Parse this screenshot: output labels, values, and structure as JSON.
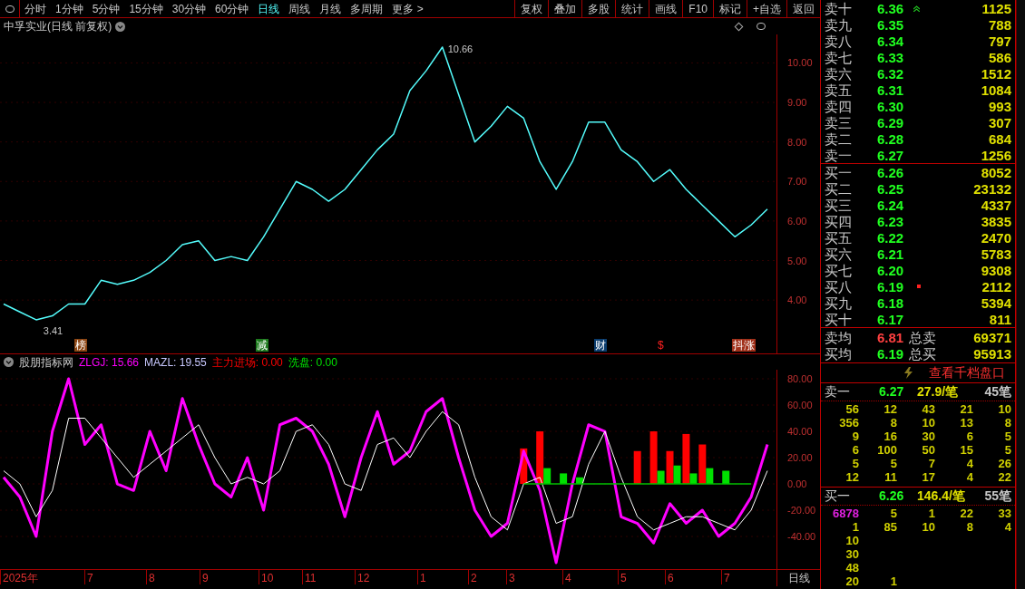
{
  "toolbar": {
    "periods": [
      {
        "label": "分时",
        "selected": false
      },
      {
        "label": "1分钟",
        "selected": false
      },
      {
        "label": "5分钟",
        "selected": false
      },
      {
        "label": "15分钟",
        "selected": false
      },
      {
        "label": "30分钟",
        "selected": false
      },
      {
        "label": "60分钟",
        "selected": false
      },
      {
        "label": "日线",
        "selected": true
      },
      {
        "label": "周线",
        "selected": false
      },
      {
        "label": "月线",
        "selected": false
      },
      {
        "label": "多周期",
        "selected": false
      },
      {
        "label": "更多 >",
        "selected": false
      }
    ],
    "actions": [
      "复权",
      "叠加",
      "多股",
      "统计",
      "画线",
      "F10",
      "标记",
      "+自选",
      "返回"
    ]
  },
  "price_chart": {
    "title": "中孚实业(日线 前复权)",
    "high_label": "10.66",
    "low_label": "3.41",
    "events": [
      {
        "text": "榜",
        "kind": "badge",
        "color": "#8b4513"
      },
      {
        "text": "减",
        "kind": "badge",
        "color": "#1e7a1e"
      },
      {
        "text": "财",
        "kind": "badge",
        "color": "#0b3d6e"
      },
      {
        "text": "$",
        "kind": "text",
        "color": "#ff2020"
      },
      {
        "text": "抖涨",
        "kind": "badge",
        "color": "#a0301a"
      }
    ],
    "chart_data": {
      "type": "line",
      "grid": true,
      "ylim": [
        3.04,
        10.72
      ],
      "yticks": [
        {
          "value": 4,
          "label": "4.00"
        },
        {
          "value": 5,
          "label": "5.00"
        },
        {
          "value": 6,
          "label": "6.00"
        },
        {
          "value": 7,
          "label": "7.00"
        },
        {
          "value": 8,
          "label": "8.00"
        },
        {
          "value": 9,
          "label": "9.00"
        },
        {
          "value": 10,
          "label": "10.00"
        }
      ],
      "series": [
        {
          "color": "#54fcfc",
          "values": [
            3.9,
            3.7,
            3.5,
            3.6,
            3.9,
            3.9,
            4.5,
            4.4,
            4.5,
            4.7,
            5.0,
            5.4,
            5.5,
            5.0,
            5.1,
            5.0,
            5.6,
            6.3,
            7.0,
            6.8,
            6.5,
            6.8,
            7.3,
            7.8,
            8.2,
            9.3,
            9.8,
            10.4,
            9.2,
            8.0,
            8.4,
            8.9,
            8.6,
            7.5,
            6.8,
            7.5,
            8.5,
            8.5,
            7.8,
            7.5,
            7.0,
            7.3,
            6.8,
            6.4,
            6.0,
            5.6,
            5.9,
            6.3
          ]
        }
      ]
    }
  },
  "indicator": {
    "name": "股朋指标网",
    "readings": [
      ": 15.66",
      ": 19.55",
      ": 0.00",
      ": 0.00"
    ],
    "chart_data": {
      "type": "line",
      "grid": true,
      "ylim": [
        -64.8,
        86.9
      ],
      "yticks": [
        {
          "value": -40,
          "label": "-40.00"
        },
        {
          "value": -20,
          "label": "-20.00"
        },
        {
          "value": 0,
          "label": "0.00"
        },
        {
          "value": 20,
          "label": "20.00"
        },
        {
          "value": 40,
          "label": "40.00"
        },
        {
          "value": 60,
          "label": "60.00"
        },
        {
          "value": 80,
          "label": "80.00"
        }
      ],
      "series": [
        {
          "name": "ZLGJ",
          "type": "line",
          "color": "#ff00ff",
          "values": [
            5,
            -10,
            -40,
            40,
            80,
            30,
            45,
            0,
            -5,
            40,
            10,
            65,
            30,
            0,
            -10,
            20,
            -20,
            45,
            50,
            40,
            15,
            -25,
            20,
            55,
            15,
            25,
            55,
            65,
            20,
            -20,
            -40,
            -30,
            25,
            -5,
            -60,
            0,
            45,
            40,
            -25,
            -30,
            -45,
            -15,
            -30,
            -20,
            -40,
            -30,
            -10,
            30
          ]
        },
        {
          "name": "MAZL",
          "type": "line",
          "color": "#ffffff",
          "values": [
            10,
            0,
            -25,
            -5,
            50,
            50,
            35,
            20,
            5,
            15,
            25,
            35,
            45,
            20,
            0,
            5,
            0,
            10,
            40,
            45,
            30,
            0,
            -5,
            30,
            35,
            20,
            40,
            55,
            45,
            5,
            -25,
            -35,
            0,
            5,
            -30,
            -25,
            15,
            40,
            5,
            -25,
            -35,
            -30,
            -25,
            -25,
            -30,
            -35,
            -20,
            10
          ]
        },
        {
          "name": "主力进场",
          "type": "bar",
          "color": "#ff0000",
          "values": [
            null,
            null,
            null,
            null,
            null,
            null,
            null,
            null,
            null,
            null,
            null,
            null,
            null,
            null,
            null,
            null,
            null,
            null,
            null,
            null,
            null,
            null,
            null,
            null,
            null,
            null,
            null,
            null,
            null,
            null,
            null,
            null,
            27,
            40,
            null,
            null,
            null,
            null,
            null,
            25,
            40,
            25,
            38,
            30,
            null,
            null,
            null,
            null
          ]
        },
        {
          "type": "line",
          "color": "#00c000",
          "values": [
            null,
            null,
            null,
            null,
            null,
            null,
            null,
            null,
            null,
            null,
            null,
            null,
            null,
            null,
            null,
            null,
            null,
            null,
            null,
            null,
            null,
            null,
            null,
            null,
            null,
            null,
            null,
            null,
            null,
            null,
            null,
            null,
            0,
            0,
            0,
            0,
            0,
            0,
            0,
            0,
            0,
            0,
            0,
            0,
            0,
            0,
            0,
            null
          ]
        },
        {
          "name": "洗盘",
          "type": "bar",
          "color": "#00e000",
          "values": [
            null,
            null,
            null,
            null,
            null,
            null,
            null,
            null,
            null,
            null,
            null,
            null,
            null,
            null,
            null,
            null,
            null,
            null,
            null,
            null,
            null,
            null,
            null,
            null,
            null,
            null,
            null,
            null,
            null,
            null,
            null,
            null,
            null,
            12,
            8,
            5,
            null,
            null,
            null,
            null,
            10,
            14,
            8,
            12,
            10,
            null,
            null,
            null
          ]
        }
      ]
    }
  },
  "time_axis": {
    "labels": [
      "2025年",
      "7",
      "8",
      "9",
      "10",
      "11",
      "12",
      "1",
      "2",
      "3",
      "4",
      "5",
      "6",
      "7"
    ],
    "period": "日线"
  },
  "order_book": {
    "asks": [
      {
        "label": "卖十",
        "price": "6.36",
        "volume": "1125",
        "up_arrow": true,
        "dot": false
      },
      {
        "label": "卖九",
        "price": "6.35",
        "volume": "788",
        "up_arrow": false,
        "dot": false
      },
      {
        "label": "卖八",
        "price": "6.34",
        "volume": "797",
        "up_arrow": false,
        "dot": false
      },
      {
        "label": "卖七",
        "price": "6.33",
        "volume": "586",
        "up_arrow": false,
        "dot": false
      },
      {
        "label": "卖六",
        "price": "6.32",
        "volume": "1512",
        "up_arrow": false,
        "dot": false
      },
      {
        "label": "卖五",
        "price": "6.31",
        "volume": "1084",
        "up_arrow": false,
        "dot": false
      },
      {
        "label": "卖四",
        "price": "6.30",
        "volume": "993",
        "up_arrow": false,
        "dot": false
      },
      {
        "label": "卖三",
        "price": "6.29",
        "volume": "307",
        "up_arrow": false,
        "dot": false
      },
      {
        "label": "卖二",
        "price": "6.28",
        "volume": "684",
        "up_arrow": false,
        "dot": false
      },
      {
        "label": "卖一",
        "price": "6.27",
        "volume": "1256",
        "up_arrow": false,
        "dot": false
      }
    ],
    "bids": [
      {
        "label": "买一",
        "price": "6.26",
        "volume": "8052",
        "up_arrow": false,
        "dot": false
      },
      {
        "label": "买二",
        "price": "6.25",
        "volume": "23132",
        "up_arrow": false,
        "dot": false
      },
      {
        "label": "买三",
        "price": "6.24",
        "volume": "4337",
        "up_arrow": false,
        "dot": false
      },
      {
        "label": "买四",
        "price": "6.23",
        "volume": "3835",
        "up_arrow": false,
        "dot": false
      },
      {
        "label": "买五",
        "price": "6.22",
        "volume": "2470",
        "up_arrow": false,
        "dot": false
      },
      {
        "label": "买六",
        "price": "6.21",
        "volume": "5783",
        "up_arrow": false,
        "dot": false
      },
      {
        "label": "买七",
        "price": "6.20",
        "volume": "9308",
        "up_arrow": false,
        "dot": false
      },
      {
        "label": "买八",
        "price": "6.19",
        "volume": "2112",
        "up_arrow": false,
        "dot": true
      },
      {
        "label": "买九",
        "price": "6.18",
        "volume": "5394",
        "up_arrow": false,
        "dot": false
      },
      {
        "label": "买十",
        "price": "6.17",
        "volume": "811",
        "up_arrow": false,
        "dot": false
      }
    ],
    "averages": [
      {
        "label": "卖均",
        "price": "6.81",
        "color": "#ff4040",
        "total_label": "总卖",
        "total": "69371"
      },
      {
        "label": "买均",
        "price": "6.19",
        "color": "#20ff20",
        "total_label": "总买",
        "total": "95913"
      }
    ],
    "depth_link": "查看千档盘口",
    "queues": [
      {
        "label": "卖一",
        "price": "6.27",
        "per_order": "27.9/笔",
        "count": "45笔",
        "rows": [
          [
            "56",
            "12",
            "43",
            "21",
            "10"
          ],
          [
            "356",
            "8",
            "10",
            "13",
            "8"
          ],
          [
            "9",
            "16",
            "30",
            "6",
            "5"
          ],
          [
            "6",
            "100",
            "50",
            "15",
            "5"
          ],
          [
            "5",
            "5",
            "7",
            "4",
            "26"
          ],
          [
            "12",
            "11",
            "17",
            "4",
            "22"
          ]
        ]
      },
      {
        "label": "买一",
        "price": "6.26",
        "per_order": "146.4/笔",
        "count": "55笔",
        "rows": [
          [
            "6878",
            "5",
            "1",
            "22",
            "33"
          ],
          [
            "1",
            "85",
            "10",
            "8",
            "4"
          ],
          [
            "10"
          ],
          [
            "30"
          ],
          [
            "48"
          ],
          [
            "20",
            "1"
          ]
        ]
      }
    ]
  }
}
